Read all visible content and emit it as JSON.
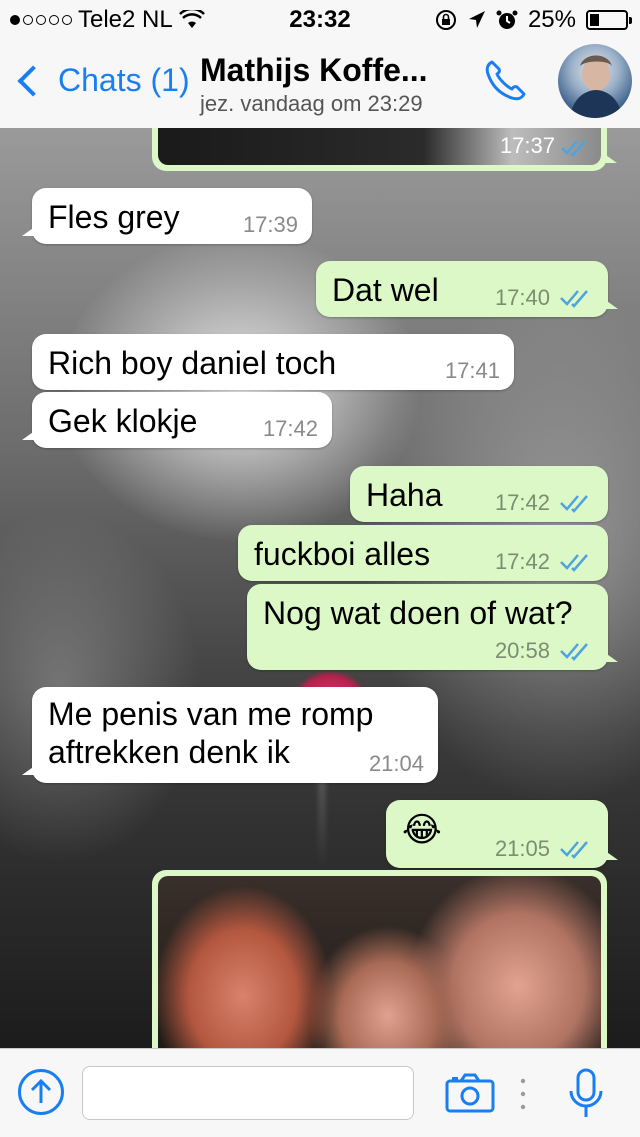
{
  "status_bar": {
    "carrier": "Tele2 NL",
    "time": "23:32",
    "battery": "25%",
    "battery_level": 0.25
  },
  "nav": {
    "back_label": "Chats (1)",
    "contact_name": "Mathijs Koffe...",
    "last_seen": "jez. vandaag om 23:29"
  },
  "messages": [
    {
      "dir": "out",
      "type": "photo",
      "time": "17:37"
    },
    {
      "dir": "in",
      "text": "Fles grey",
      "time": "17:39"
    },
    {
      "dir": "out",
      "text": "Dat wel",
      "time": "17:40"
    },
    {
      "dir": "in",
      "text": "Rich boy daniel toch",
      "time": "17:41"
    },
    {
      "dir": "in",
      "text": "Gek klokje",
      "time": "17:42"
    },
    {
      "dir": "out",
      "text": "Haha",
      "time": "17:42"
    },
    {
      "dir": "out",
      "text": "fuckboi alles",
      "time": "17:42"
    },
    {
      "dir": "out",
      "text": "Nog wat doen of wat?",
      "time": "20:58"
    },
    {
      "dir": "in",
      "text_line1": "Me penis van me romp",
      "text_line2": "aftrekken denk ik",
      "time": "21:04"
    },
    {
      "dir": "out",
      "text": "😂",
      "time": "21:05"
    },
    {
      "dir": "out",
      "type": "photo"
    }
  ],
  "input": {
    "placeholder": ""
  },
  "colors": {
    "accent": "#1a7ef3",
    "outgoing_bubble": "#dcf8c6",
    "incoming_bubble": "#ffffff",
    "read_ticks": "#4fa3e0"
  }
}
